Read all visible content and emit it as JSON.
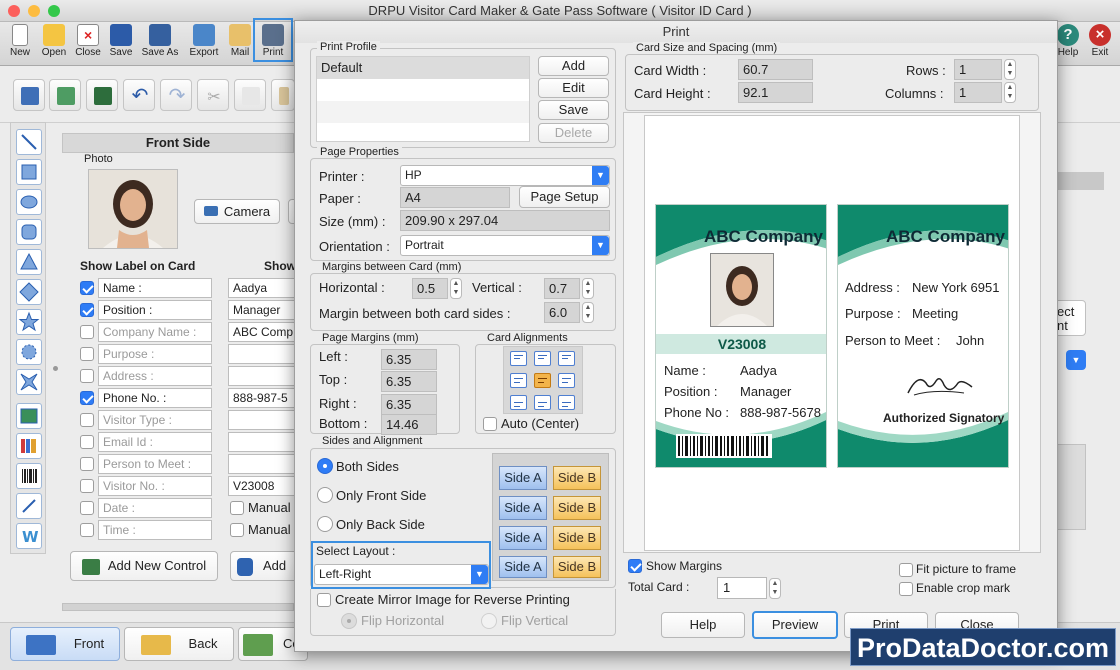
{
  "app": {
    "title": "DRPU Visitor Card Maker & Gate Pass Software ( Visitor ID Card )"
  },
  "toolbar": {
    "items": [
      {
        "label": "New",
        "icon": "new-doc-icon"
      },
      {
        "label": "Open",
        "icon": "open-folder-icon"
      },
      {
        "label": "Close",
        "icon": "close-doc-icon"
      },
      {
        "label": "Save",
        "icon": "save-disk-icon"
      },
      {
        "label": "Save As",
        "icon": "save-as-icon"
      },
      {
        "label": "Export",
        "icon": "export-icon"
      },
      {
        "label": "Mail",
        "icon": "mail-icon"
      },
      {
        "label": "Print",
        "icon": "printer-icon"
      }
    ],
    "help": "Help",
    "exit": "Exit"
  },
  "left_panel": {
    "section_title": "Front Side",
    "photo_label": "Photo",
    "camera_button": "Camera",
    "show_label_header": "Show Label on Card",
    "show_value_header": "Show",
    "rows": [
      {
        "checked": true,
        "label": "Name :",
        "value": "Aadya",
        "enabled": true
      },
      {
        "checked": true,
        "label": "Position :",
        "value": "Manager",
        "enabled": true
      },
      {
        "checked": false,
        "label": "Company Name :",
        "value": "ABC Comp",
        "enabled": false
      },
      {
        "checked": false,
        "label": "Purpose :",
        "value": "",
        "enabled": false
      },
      {
        "checked": false,
        "label": "Address :",
        "value": "",
        "enabled": false
      },
      {
        "checked": true,
        "label": "Phone No. :",
        "value": "888-987-5",
        "enabled": true
      },
      {
        "checked": false,
        "label": "Visitor Type :",
        "value": "",
        "enabled": false
      },
      {
        "checked": false,
        "label": "Email Id :",
        "value": "",
        "enabled": false
      },
      {
        "checked": false,
        "label": "Person to Meet :",
        "value": "",
        "enabled": false
      },
      {
        "checked": false,
        "label": "Visitor No. :",
        "value": "V23008",
        "enabled": false
      },
      {
        "checked": false,
        "label": "Date :",
        "value": "Manual",
        "enabled": false
      },
      {
        "checked": false,
        "label": "Time :",
        "value": "Manual",
        "enabled": false
      }
    ],
    "add_new_control": "Add New Control",
    "add_button": "Add"
  },
  "bottom_tabs": {
    "front": "Front",
    "back": "Back",
    "third": "Co"
  },
  "right_partial": {
    "select_text": "ect",
    "select_text2": "nt"
  },
  "print_dialog": {
    "title": "Print",
    "print_profile": {
      "title": "Print Profile",
      "profiles": [
        "Default"
      ],
      "add": "Add",
      "edit": "Edit",
      "save": "Save",
      "delete": "Delete"
    },
    "page_properties": {
      "title": "Page Properties",
      "printer_label": "Printer :",
      "printer_value": "HP",
      "paper_label": "Paper :",
      "paper_value": "A4",
      "page_setup": "Page Setup",
      "size_label": "Size (mm) :",
      "size_value": "209.90 x 297.04",
      "orientation_label": "Orientation :",
      "orientation_value": "Portrait"
    },
    "margins_between_card": {
      "title": "Margins between Card (mm)",
      "horizontal_label": "Horizontal :",
      "horizontal_value": "0.5",
      "vertical_label": "Vertical :",
      "vertical_value": "0.7",
      "both_label": "Margin between both card sides :",
      "both_value": "6.0"
    },
    "page_margins": {
      "title": "Page Margins (mm)",
      "left_label": "Left :",
      "left_value": "6.35",
      "top_label": "Top :",
      "top_value": "6.35",
      "right_label": "Right :",
      "right_value": "6.35",
      "bottom_label": "Bottom :",
      "bottom_value": "14.46"
    },
    "card_alignments": {
      "title": "Card Alignments",
      "auto_center": "Auto (Center)",
      "selected": "middle-center"
    },
    "sides": {
      "title": "Sides and Alignment",
      "both_sides": "Both Sides",
      "only_front": "Only Front Side",
      "only_back": "Only Back Side",
      "selected": "both",
      "select_layout_label": "Select Layout :",
      "layout_value": "Left-Right",
      "side_a": "Side A",
      "side_b": "Side B"
    },
    "mirror": {
      "label": "Create Mirror Image for Reverse Printing",
      "checked": false,
      "flip_horizontal": "Flip Horizontal",
      "flip_vertical": "Flip Vertical"
    },
    "card_size": {
      "title": "Card Size and Spacing (mm)",
      "width_label": "Card Width :",
      "width_value": "60.7",
      "height_label": "Card Height :",
      "height_value": "92.1",
      "rows_label": "Rows :",
      "rows_value": "1",
      "columns_label": "Columns :",
      "columns_value": "1"
    },
    "preview_card_front": {
      "company": "ABC Company",
      "visitor_no": "V23008",
      "name_label": "Name :",
      "name_value": "Aadya",
      "position_label": "Position :",
      "position_value": "Manager",
      "phone_label": "Phone No :",
      "phone_value": "888-987-5678"
    },
    "preview_card_back": {
      "company": "ABC Company",
      "address_label": "Address :",
      "address_value": "New York 6951",
      "purpose_label": "Purpose :",
      "purpose_value": "Meeting",
      "person_label": "Person to Meet :",
      "person_value": "John",
      "signatory": "Authorized Signatory"
    },
    "options": {
      "show_margins": "Show Margins",
      "show_margins_checked": true,
      "fit_picture": "Fit picture to frame",
      "fit_picture_checked": false,
      "crop_mark": "Enable crop mark",
      "crop_mark_checked": false,
      "total_card_label": "Total Card :",
      "total_card_value": "1"
    },
    "buttons": {
      "help": "Help",
      "preview": "Preview",
      "print": "Print",
      "close": "Close"
    }
  },
  "watermark": "ProDataDoctor.com",
  "colors": {
    "accent_blue": "#2e7cf6",
    "highlight_border": "#3b8fe0",
    "card_green": "#0f8a6c",
    "card_name_band": "#cfe9e0"
  }
}
